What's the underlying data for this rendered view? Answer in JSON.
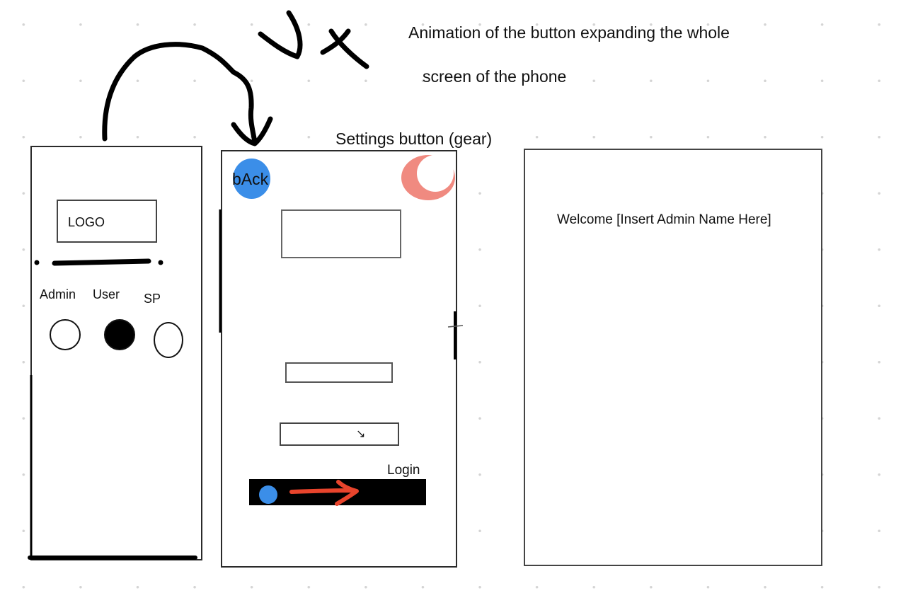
{
  "annotations": {
    "animation_line1": "Animation of the button expanding the whole",
    "animation_line2": "screen of the phone",
    "settings_note": "Settings button (gear)"
  },
  "screen1": {
    "logo_label": "LOGO",
    "roles": [
      {
        "label": "Admin",
        "selected": false
      },
      {
        "label": "User",
        "selected": true
      },
      {
        "label": "SP",
        "selected": false
      }
    ]
  },
  "screen2": {
    "back_label": "bAck",
    "login_label": "Login",
    "back_color": "#3b8ee8",
    "gear_color": "#f08a80",
    "arrow_color": "#e8442c"
  },
  "screen3": {
    "welcome_text": "Welcome [Insert Admin Name Here]"
  }
}
